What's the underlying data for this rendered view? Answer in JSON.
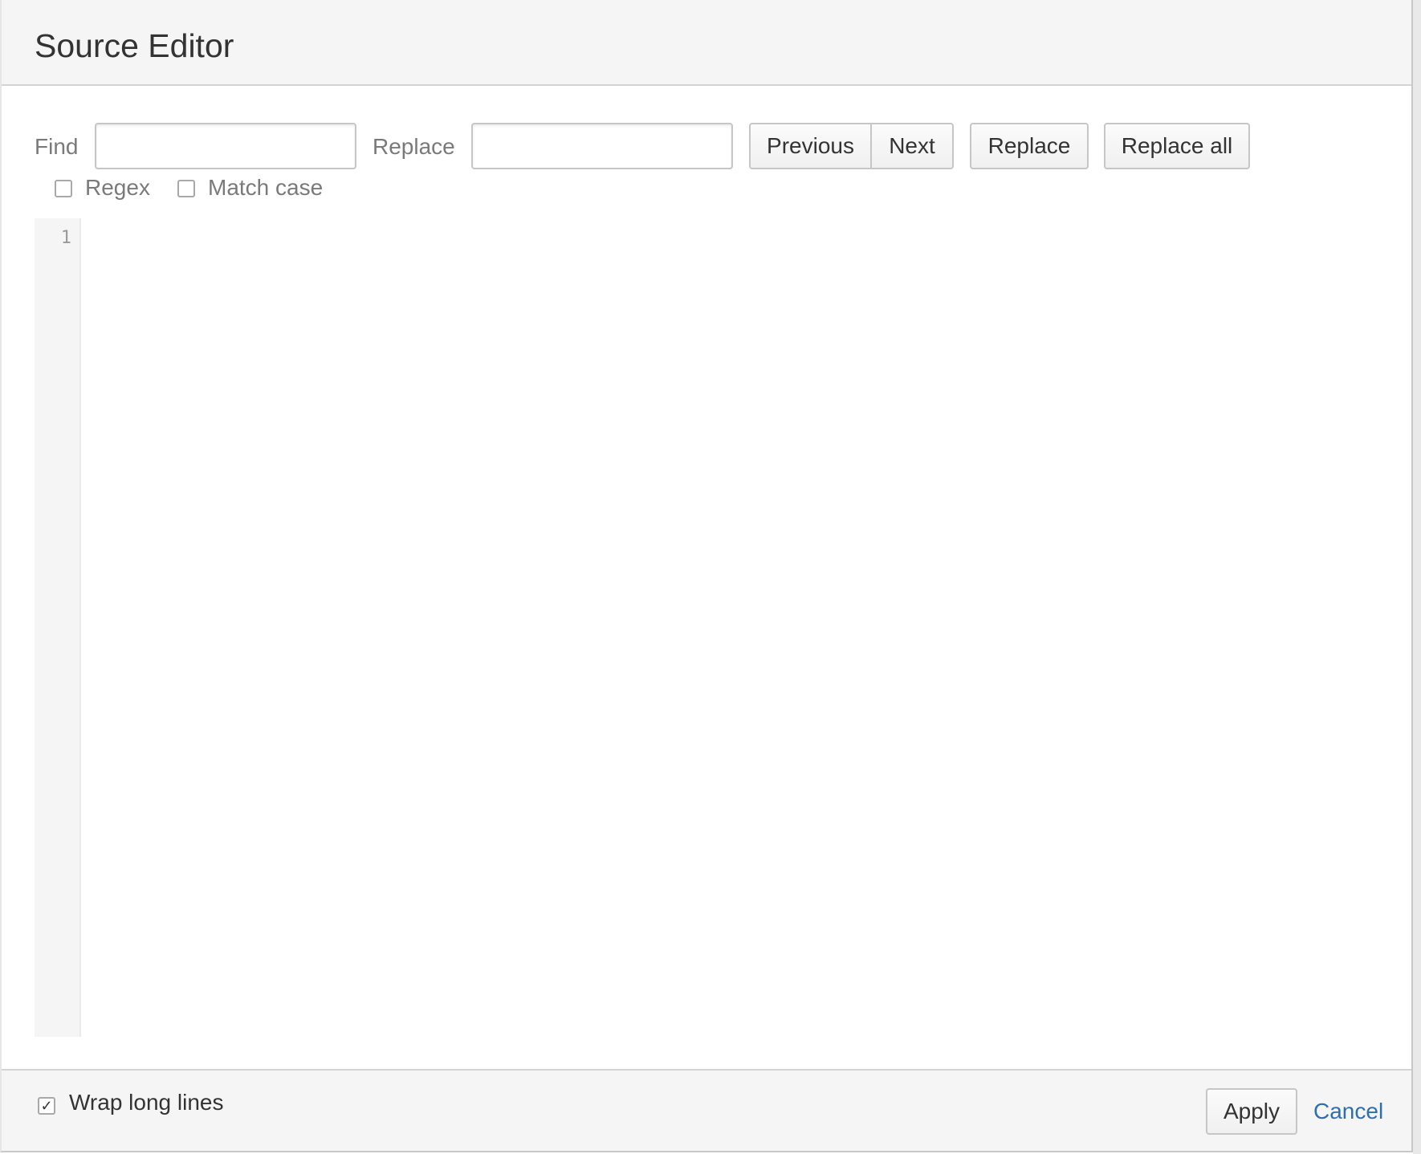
{
  "dialog": {
    "title": "Source Editor"
  },
  "search_bar": {
    "find_label": "Find",
    "find_value": "",
    "replace_label": "Replace",
    "replace_value": "",
    "previous_button": "Previous",
    "next_button": "Next",
    "replace_button": "Replace",
    "replace_all_button": "Replace all",
    "regex_label": "Regex",
    "regex_checked": false,
    "match_case_label": "Match case",
    "match_case_checked": false
  },
  "editor": {
    "line_numbers": [
      "1"
    ],
    "content": ""
  },
  "footer": {
    "wrap_label": "Wrap long lines",
    "wrap_checked": true,
    "wrap_check_glyph": "✓",
    "apply_button": "Apply",
    "cancel_link": "Cancel"
  },
  "colors": {
    "link": "#2f6fb0",
    "header_bg": "#f5f5f5"
  }
}
